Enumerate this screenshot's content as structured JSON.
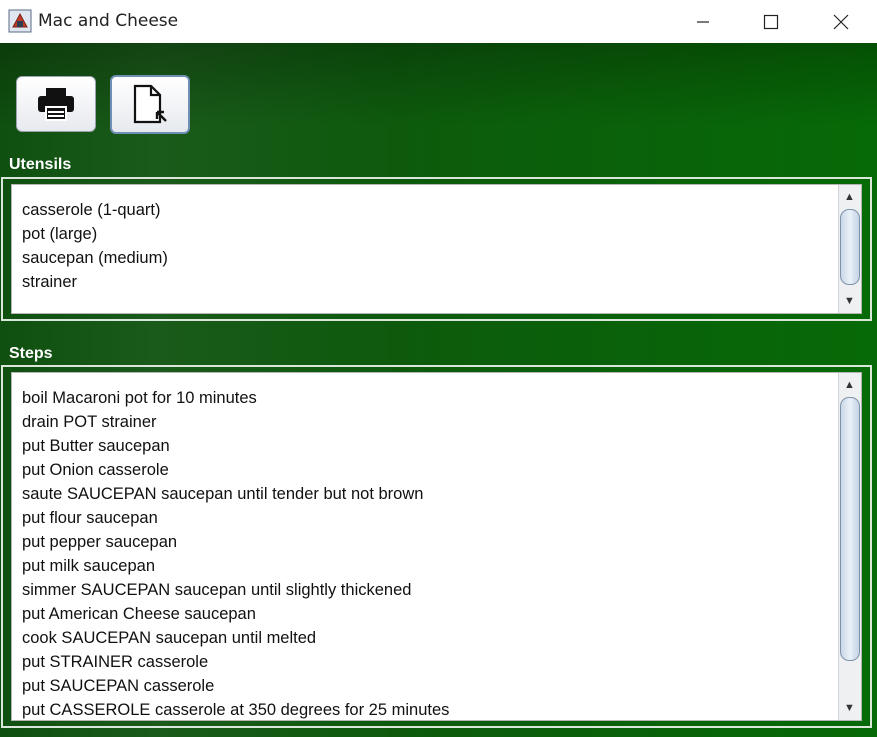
{
  "window": {
    "title": "Mac and Cheese",
    "controls": {
      "minimize": "minimize-icon",
      "maximize": "maximize-icon",
      "close": "close-icon"
    }
  },
  "toolbar": {
    "buttons": [
      {
        "name": "print-button",
        "icon": "printer-icon"
      },
      {
        "name": "export-button",
        "icon": "document-cursor-icon"
      }
    ]
  },
  "utensils": {
    "label": "Utensils",
    "items": [
      "casserole (1-quart)",
      "pot (large)",
      "saucepan (medium)",
      "strainer"
    ]
  },
  "steps": {
    "label": "Steps",
    "items": [
      "boil Macaroni pot for 10 minutes",
      "drain POT strainer",
      "put Butter saucepan",
      "put Onion casserole",
      "saute SAUCEPAN saucepan until tender but not brown",
      "put flour saucepan",
      "put pepper saucepan",
      "put milk saucepan",
      "simmer SAUCEPAN saucepan until slightly thickened",
      "put American Cheese saucepan",
      "cook SAUCEPAN saucepan until melted",
      "put STRAINER casserole",
      "put SAUCEPAN casserole",
      "put CASSEROLE casserole at 350 degrees for 25 minutes"
    ]
  },
  "colors": {
    "background_green": "#0d5a0d",
    "panel_white": "#ffffff",
    "label_white": "#ffffff"
  }
}
